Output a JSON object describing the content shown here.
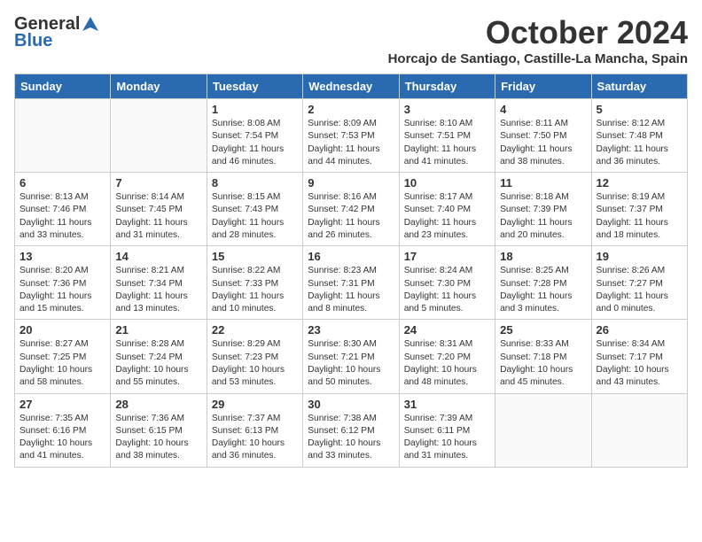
{
  "logo": {
    "general": "General",
    "blue": "Blue"
  },
  "title": "October 2024",
  "location": "Horcajo de Santiago, Castille-La Mancha, Spain",
  "weekdays": [
    "Sunday",
    "Monday",
    "Tuesday",
    "Wednesday",
    "Thursday",
    "Friday",
    "Saturday"
  ],
  "weeks": [
    [
      {
        "day": "",
        "info": ""
      },
      {
        "day": "",
        "info": ""
      },
      {
        "day": "1",
        "info": "Sunrise: 8:08 AM\nSunset: 7:54 PM\nDaylight: 11 hours and 46 minutes."
      },
      {
        "day": "2",
        "info": "Sunrise: 8:09 AM\nSunset: 7:53 PM\nDaylight: 11 hours and 44 minutes."
      },
      {
        "day": "3",
        "info": "Sunrise: 8:10 AM\nSunset: 7:51 PM\nDaylight: 11 hours and 41 minutes."
      },
      {
        "day": "4",
        "info": "Sunrise: 8:11 AM\nSunset: 7:50 PM\nDaylight: 11 hours and 38 minutes."
      },
      {
        "day": "5",
        "info": "Sunrise: 8:12 AM\nSunset: 7:48 PM\nDaylight: 11 hours and 36 minutes."
      }
    ],
    [
      {
        "day": "6",
        "info": "Sunrise: 8:13 AM\nSunset: 7:46 PM\nDaylight: 11 hours and 33 minutes."
      },
      {
        "day": "7",
        "info": "Sunrise: 8:14 AM\nSunset: 7:45 PM\nDaylight: 11 hours and 31 minutes."
      },
      {
        "day": "8",
        "info": "Sunrise: 8:15 AM\nSunset: 7:43 PM\nDaylight: 11 hours and 28 minutes."
      },
      {
        "day": "9",
        "info": "Sunrise: 8:16 AM\nSunset: 7:42 PM\nDaylight: 11 hours and 26 minutes."
      },
      {
        "day": "10",
        "info": "Sunrise: 8:17 AM\nSunset: 7:40 PM\nDaylight: 11 hours and 23 minutes."
      },
      {
        "day": "11",
        "info": "Sunrise: 8:18 AM\nSunset: 7:39 PM\nDaylight: 11 hours and 20 minutes."
      },
      {
        "day": "12",
        "info": "Sunrise: 8:19 AM\nSunset: 7:37 PM\nDaylight: 11 hours and 18 minutes."
      }
    ],
    [
      {
        "day": "13",
        "info": "Sunrise: 8:20 AM\nSunset: 7:36 PM\nDaylight: 11 hours and 15 minutes."
      },
      {
        "day": "14",
        "info": "Sunrise: 8:21 AM\nSunset: 7:34 PM\nDaylight: 11 hours and 13 minutes."
      },
      {
        "day": "15",
        "info": "Sunrise: 8:22 AM\nSunset: 7:33 PM\nDaylight: 11 hours and 10 minutes."
      },
      {
        "day": "16",
        "info": "Sunrise: 8:23 AM\nSunset: 7:31 PM\nDaylight: 11 hours and 8 minutes."
      },
      {
        "day": "17",
        "info": "Sunrise: 8:24 AM\nSunset: 7:30 PM\nDaylight: 11 hours and 5 minutes."
      },
      {
        "day": "18",
        "info": "Sunrise: 8:25 AM\nSunset: 7:28 PM\nDaylight: 11 hours and 3 minutes."
      },
      {
        "day": "19",
        "info": "Sunrise: 8:26 AM\nSunset: 7:27 PM\nDaylight: 11 hours and 0 minutes."
      }
    ],
    [
      {
        "day": "20",
        "info": "Sunrise: 8:27 AM\nSunset: 7:25 PM\nDaylight: 10 hours and 58 minutes."
      },
      {
        "day": "21",
        "info": "Sunrise: 8:28 AM\nSunset: 7:24 PM\nDaylight: 10 hours and 55 minutes."
      },
      {
        "day": "22",
        "info": "Sunrise: 8:29 AM\nSunset: 7:23 PM\nDaylight: 10 hours and 53 minutes."
      },
      {
        "day": "23",
        "info": "Sunrise: 8:30 AM\nSunset: 7:21 PM\nDaylight: 10 hours and 50 minutes."
      },
      {
        "day": "24",
        "info": "Sunrise: 8:31 AM\nSunset: 7:20 PM\nDaylight: 10 hours and 48 minutes."
      },
      {
        "day": "25",
        "info": "Sunrise: 8:33 AM\nSunset: 7:18 PM\nDaylight: 10 hours and 45 minutes."
      },
      {
        "day": "26",
        "info": "Sunrise: 8:34 AM\nSunset: 7:17 PM\nDaylight: 10 hours and 43 minutes."
      }
    ],
    [
      {
        "day": "27",
        "info": "Sunrise: 7:35 AM\nSunset: 6:16 PM\nDaylight: 10 hours and 41 minutes."
      },
      {
        "day": "28",
        "info": "Sunrise: 7:36 AM\nSunset: 6:15 PM\nDaylight: 10 hours and 38 minutes."
      },
      {
        "day": "29",
        "info": "Sunrise: 7:37 AM\nSunset: 6:13 PM\nDaylight: 10 hours and 36 minutes."
      },
      {
        "day": "30",
        "info": "Sunrise: 7:38 AM\nSunset: 6:12 PM\nDaylight: 10 hours and 33 minutes."
      },
      {
        "day": "31",
        "info": "Sunrise: 7:39 AM\nSunset: 6:11 PM\nDaylight: 10 hours and 31 minutes."
      },
      {
        "day": "",
        "info": ""
      },
      {
        "day": "",
        "info": ""
      }
    ]
  ]
}
